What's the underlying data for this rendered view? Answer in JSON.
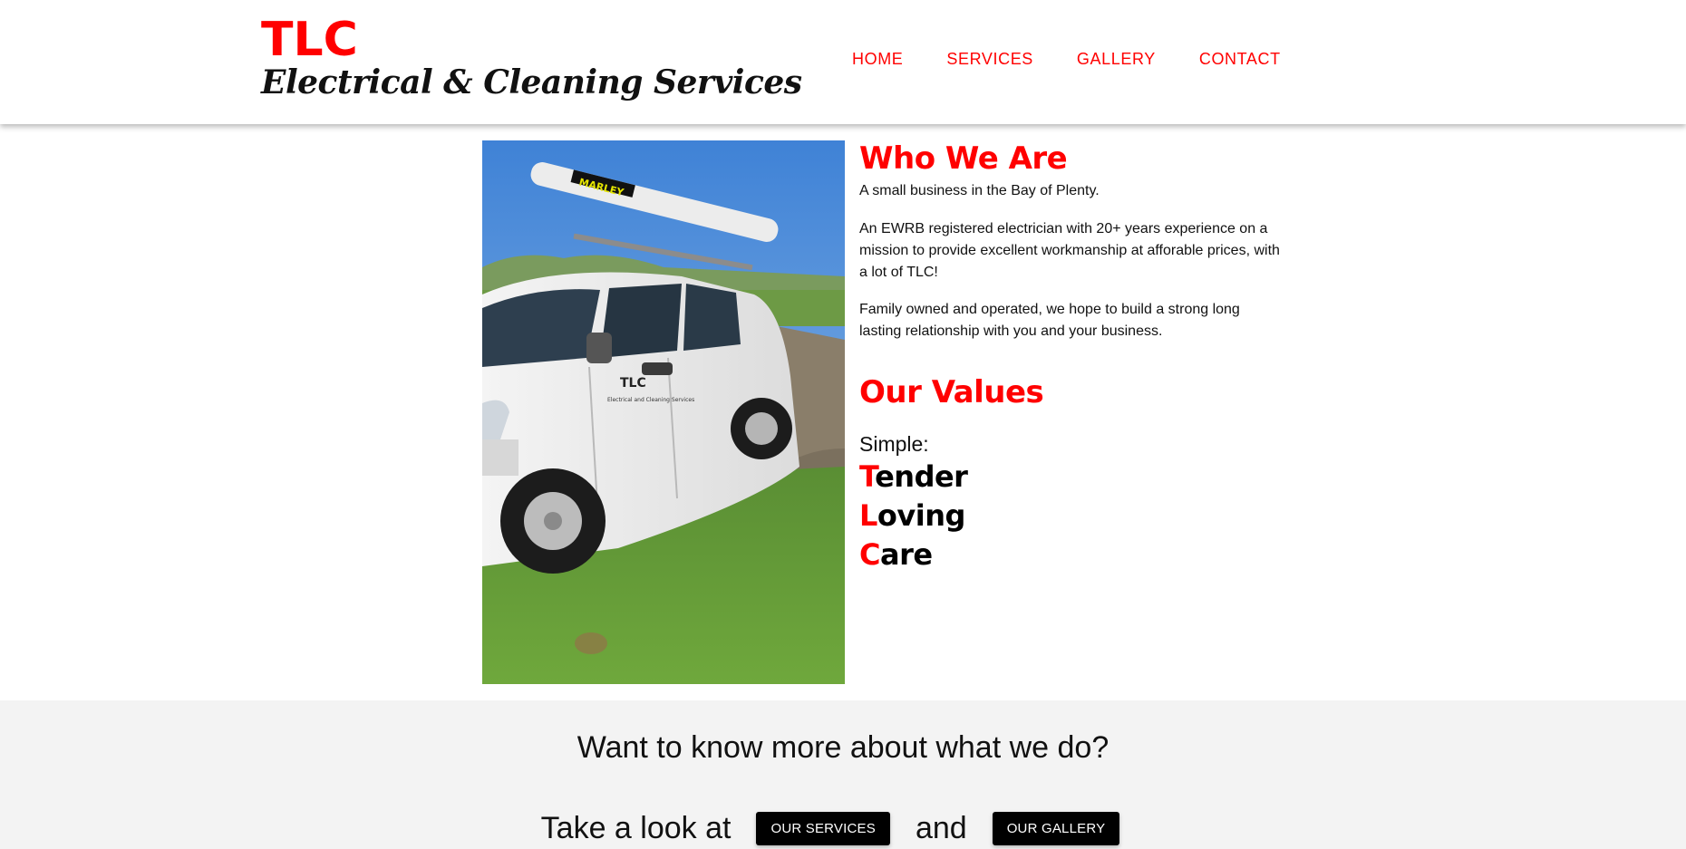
{
  "header": {
    "logo_title": "TLC",
    "logo_subtitle": "Electrical & Cleaning Services",
    "nav": [
      "HOME",
      "SERVICES",
      "GALLERY",
      "CONTACT"
    ]
  },
  "photo": {
    "subject": "White van with TLC Electrical and Cleaning Services signage parked on grass",
    "van_sign_title": "TLC",
    "van_sign_subtitle": "Electrical and Cleaning Services",
    "roof_tube_label": "MARLEY"
  },
  "who": {
    "title": "Who We Are",
    "p1": "A small business in the Bay of Plenty.",
    "p2": "An EWRB registered electrician with 20+ years experience on a mission to provide excellent workmanship at afforable prices, with a lot of TLC!",
    "p3": "Family owned and operated, we hope to build a strong long lasting relationship with you and your business."
  },
  "values": {
    "title": "Our Values",
    "lead": "Simple:",
    "words": [
      {
        "initial": "T",
        "rest": "ender"
      },
      {
        "initial": "L",
        "rest": "oving"
      },
      {
        "initial": "C",
        "rest": "are"
      }
    ]
  },
  "cta": {
    "heading": "Want to know more about what we do?",
    "lead": "Take a look at",
    "services_button": "OUR SERVICES",
    "joiner": "and",
    "gallery_button": "OUR GALLERY"
  },
  "colors": {
    "accent": "#ff0000",
    "band_background": "#f3f3f3",
    "button_background": "#000000"
  }
}
